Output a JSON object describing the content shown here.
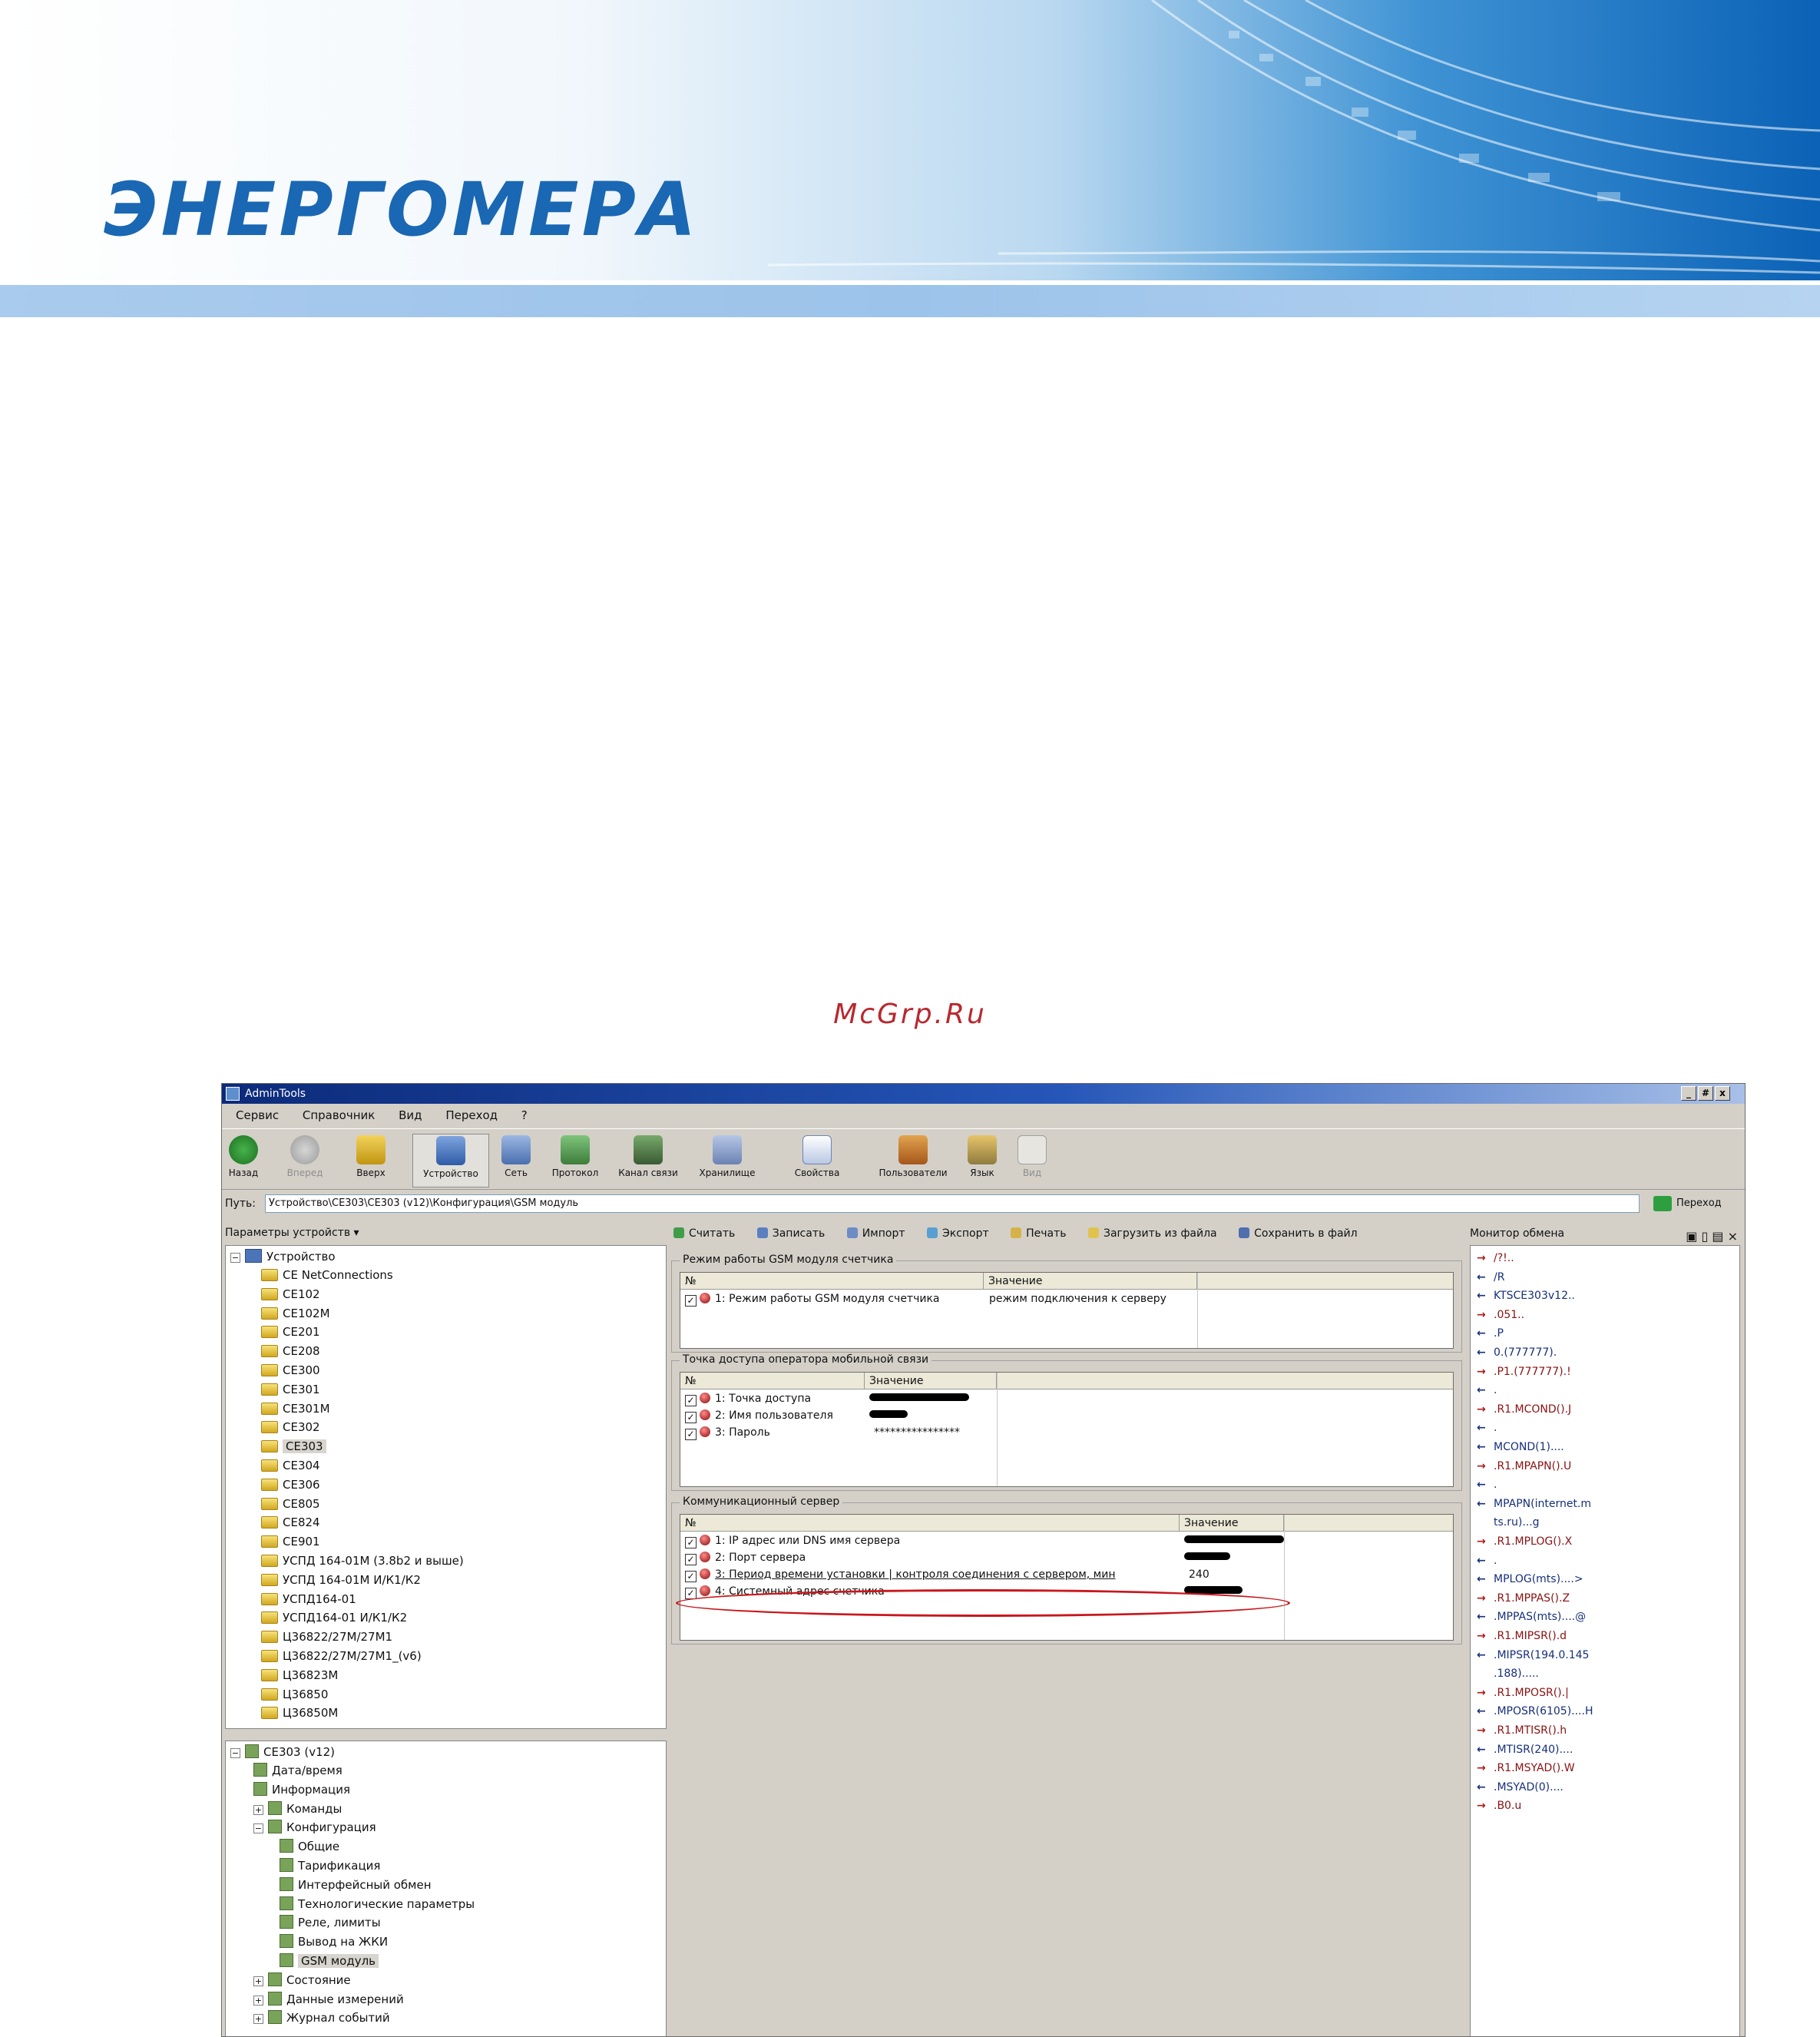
{
  "brand": {
    "logo_text": "ЭНЕРГОМЕРА"
  },
  "watermark": "McGrp.Ru",
  "window": {
    "title": "AdminTools",
    "controls": [
      "_",
      "#",
      "x"
    ],
    "menu": [
      "Сервис",
      "Справочник",
      "Вид",
      "Переход",
      "?"
    ],
    "toolbar": [
      {
        "label": "Назад",
        "icon": "back-arrow-icon",
        "state": "normal"
      },
      {
        "label": "Вперед",
        "icon": "forward-arrow-icon",
        "state": "disabled"
      },
      {
        "label": "Вверх",
        "icon": "up-arrow-icon",
        "state": "normal"
      },
      {
        "label": "Устройство",
        "icon": "device-icon",
        "state": "active"
      },
      {
        "label": "Сеть",
        "icon": "network-icon",
        "state": "normal"
      },
      {
        "label": "Протокол",
        "icon": "protocol-icon",
        "state": "normal"
      },
      {
        "label": "Канал связи",
        "icon": "channel-icon",
        "state": "normal"
      },
      {
        "label": "Хранилище",
        "icon": "storage-icon",
        "state": "normal"
      },
      {
        "label": "Свойства",
        "icon": "properties-icon",
        "state": "normal"
      },
      {
        "label": "Пользователи",
        "icon": "users-icon",
        "state": "normal"
      },
      {
        "label": "Язык",
        "icon": "language-icon",
        "state": "normal"
      },
      {
        "label": "Вид",
        "icon": "view-icon",
        "state": "disabled"
      }
    ],
    "path": {
      "label": "Путь:",
      "value": "Устройство\\CE303\\CE303 (v12)\\Конфигурация\\GSM модуль",
      "go_label": "Переход"
    }
  },
  "left_panel": {
    "title": "Параметры устройств ▾",
    "tree_root": "Устройство",
    "devices": [
      "CE NetConnections",
      "CE102",
      "CE102M",
      "CE201",
      "CE208",
      "CE300",
      "CE301",
      "CE301M",
      "CE302",
      "CE303",
      "CE304",
      "CE306",
      "CE805",
      "CE824",
      "CE901",
      "УСПД 164-01М (3.8b2 и выше)",
      "УСПД 164-01М И/К1/К2",
      "УСПД164-01",
      "УСПД164-01 И/К1/К2",
      "Ц36822/27М/27М1",
      "Ц36822/27М/27М1_(v6)",
      "Ц36823М",
      "Ц36850",
      "Ц36850М"
    ],
    "selected_device": "CE303",
    "device_tree_root": "CE303 (v12)",
    "device_nodes": [
      {
        "label": "Дата/время",
        "level": 1
      },
      {
        "label": "Информация",
        "level": 1
      },
      {
        "label": "Команды",
        "level": 1,
        "expander": "+"
      },
      {
        "label": "Конфигурация",
        "level": 1,
        "expander": "-"
      },
      {
        "label": "Общие",
        "level": 2
      },
      {
        "label": "Тарификация",
        "level": 2
      },
      {
        "label": "Интерфейсный обмен",
        "level": 2
      },
      {
        "label": "Технологические параметры",
        "level": 2
      },
      {
        "label": "Реле, лимиты",
        "level": 2
      },
      {
        "label": "Вывод на ЖКИ",
        "level": 2
      },
      {
        "label": "GSM модуль",
        "level": 2,
        "selected": true
      },
      {
        "label": "Состояние",
        "level": 1,
        "expander": "+"
      },
      {
        "label": "Данные измерений",
        "level": 1,
        "expander": "+"
      },
      {
        "label": "Журнал событий",
        "level": 1,
        "expander": "+"
      }
    ]
  },
  "center": {
    "actions": [
      "Считать",
      "Записать",
      "Импорт",
      "Экспорт",
      "Печать",
      "Загрузить из файла",
      "Сохранить в файл"
    ],
    "groups": [
      {
        "title": "Режим работы GSM модуля счетчика",
        "headers": [
          "№",
          "Значение"
        ],
        "rows": [
          {
            "name": "1: Режим работы GSM модуля счетчика",
            "value": "режим подключения к серверу"
          }
        ]
      },
      {
        "title": "Точка доступа оператора мобильной связи",
        "headers": [
          "№",
          "Значение"
        ],
        "rows": [
          {
            "name": "1: Точка доступа",
            "value": ""
          },
          {
            "name": "2: Имя пользователя",
            "value": ""
          },
          {
            "name": "3: Пароль",
            "value": "****************"
          }
        ]
      },
      {
        "title": "Коммуникационный сервер",
        "headers": [
          "№",
          "Значение"
        ],
        "rows": [
          {
            "name": "1: IP адрес или DNS имя сервера",
            "value": ""
          },
          {
            "name": "2: Порт сервера",
            "value": ""
          },
          {
            "name": "3: Период времени установки | контроля соединения с сервером, мин",
            "value": "240"
          },
          {
            "name": "4: Системный адрес счетчика",
            "value": ""
          }
        ]
      }
    ]
  },
  "monitor": {
    "title": "Монитор обмена",
    "icons": [
      "save-icon",
      "page-icon",
      "clear-icon",
      "close-icon"
    ],
    "entries": [
      {
        "dir": "out",
        "text": "/?!.."
      },
      {
        "dir": "in",
        "text": "/R"
      },
      {
        "dir": "in",
        "text": "KTSCE303v12.."
      },
      {
        "dir": "out",
        "text": ".051.."
      },
      {
        "dir": "in",
        "text": ".P"
      },
      {
        "dir": "in",
        "text": "0.(777777)."
      },
      {
        "dir": "out",
        "text": ".P1.(777777).!"
      },
      {
        "dir": "in",
        "text": "."
      },
      {
        "dir": "out",
        "text": ".R1.MCOND().J"
      },
      {
        "dir": "in",
        "text": "."
      },
      {
        "dir": "in",
        "text": "MCOND(1)...."
      },
      {
        "dir": "out",
        "text": ".R1.MPAPN().U"
      },
      {
        "dir": "in",
        "text": "."
      },
      {
        "dir": "in",
        "text": "MPAPN(internet.m"
      },
      {
        "dir": "cont",
        "text": "ts.ru)...g"
      },
      {
        "dir": "out",
        "text": ".R1.MPLOG().X"
      },
      {
        "dir": "in",
        "text": "."
      },
      {
        "dir": "in",
        "text": "MPLOG(mts)....>"
      },
      {
        "dir": "out",
        "text": ".R1.MPPAS().Z"
      },
      {
        "dir": "in",
        "text": ".MPPAS(mts)....@"
      },
      {
        "dir": "out",
        "text": ".R1.MIPSR().d"
      },
      {
        "dir": "in",
        "text": ".MIPSR(194.0.145"
      },
      {
        "dir": "cont",
        "text": ".188)....."
      },
      {
        "dir": "out",
        "text": ".R1.MPOSR().|"
      },
      {
        "dir": "in",
        "text": ".MPOSR(6105)....H"
      },
      {
        "dir": "out",
        "text": ".R1.MTISR().h"
      },
      {
        "dir": "in",
        "text": ".MTISR(240)...."
      },
      {
        "dir": "out",
        "text": ".R1.MSYAD().W"
      },
      {
        "dir": "in",
        "text": ".MSYAD(0)...."
      },
      {
        "dir": "out",
        "text": ".B0.u"
      }
    ]
  },
  "colors": {
    "accent": "#1a67b3",
    "highlight": "#c8171c",
    "watermark": "#b8292f"
  }
}
